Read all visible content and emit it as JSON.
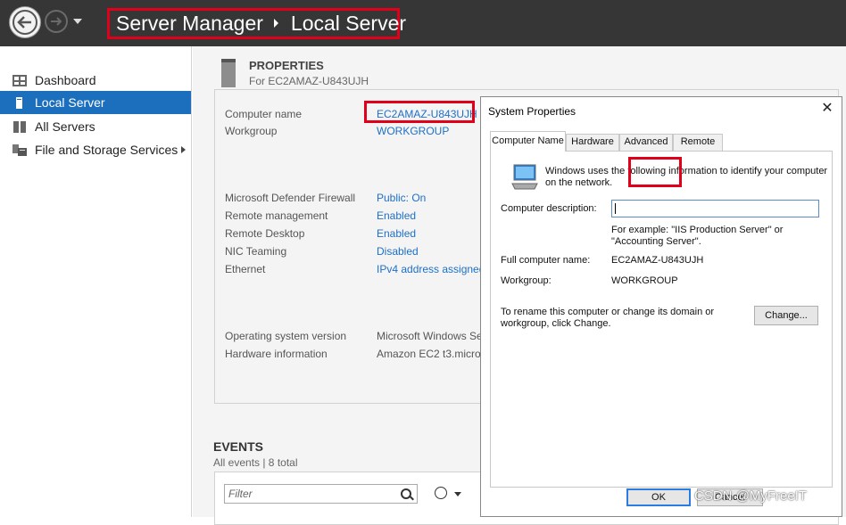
{
  "header": {
    "breadcrumb_app": "Server Manager",
    "breadcrumb_page": "Local Server"
  },
  "sidebar": {
    "items": [
      {
        "label": "Dashboard",
        "icon": "dashboard-icon"
      },
      {
        "label": "Local Server",
        "icon": "server-icon",
        "selected": true
      },
      {
        "label": "All Servers",
        "icon": "servers-icon"
      },
      {
        "label": "File and Storage Services",
        "icon": "storage-icon",
        "has_submenu": true
      }
    ]
  },
  "properties": {
    "title": "PROPERTIES",
    "subtitle": "For EC2AMAZ-U843UJH",
    "rows": [
      {
        "label": "Computer name",
        "value": "EC2AMAZ-U843UJH"
      },
      {
        "label": "Workgroup",
        "value": "WORKGROUP"
      },
      {
        "label": "Microsoft Defender Firewall",
        "value": "Public: On"
      },
      {
        "label": "Remote management",
        "value": "Enabled"
      },
      {
        "label": "Remote Desktop",
        "value": "Enabled"
      },
      {
        "label": "NIC Teaming",
        "value": "Disabled"
      },
      {
        "label": "Ethernet",
        "value": "IPv4 address assigned"
      },
      {
        "label": "Operating system version",
        "value": "Microsoft Windows Se"
      },
      {
        "label": "Hardware information",
        "value": "Amazon EC2 t3.micro"
      }
    ]
  },
  "events": {
    "title": "EVENTS",
    "subtitle": "All events | 8 total",
    "filter_placeholder": "Filter"
  },
  "dialog": {
    "title": "System Properties",
    "tabs": [
      "Computer Name",
      "Hardware",
      "Advanced",
      "Remote"
    ],
    "active_tab": "Computer Name",
    "intro_line1": "Windows uses the following information to identify your computer",
    "intro_line2": "on the network.",
    "desc_label": "Computer description:",
    "desc_value": "",
    "example_line1": "For example: \"IIS Production Server\" or",
    "example_line2": "\"Accounting Server\".",
    "full_name_label": "Full computer name:",
    "full_name_value": "EC2AMAZ-U843UJH",
    "workgroup_label": "Workgroup:",
    "workgroup_value": "WORKGROUP",
    "rename_line1": "To rename this computer or change its domain or",
    "rename_line2": "workgroup, click Change.",
    "change_button": "Change...",
    "ok_button": "OK",
    "cancel_button": "Cancel"
  },
  "watermark": "CSDN @MyFreeIT",
  "colors": {
    "header_bg": "#363636",
    "selection": "#1c6fbd",
    "link": "#1e6fc7",
    "highlight_box": "#e0001a"
  }
}
